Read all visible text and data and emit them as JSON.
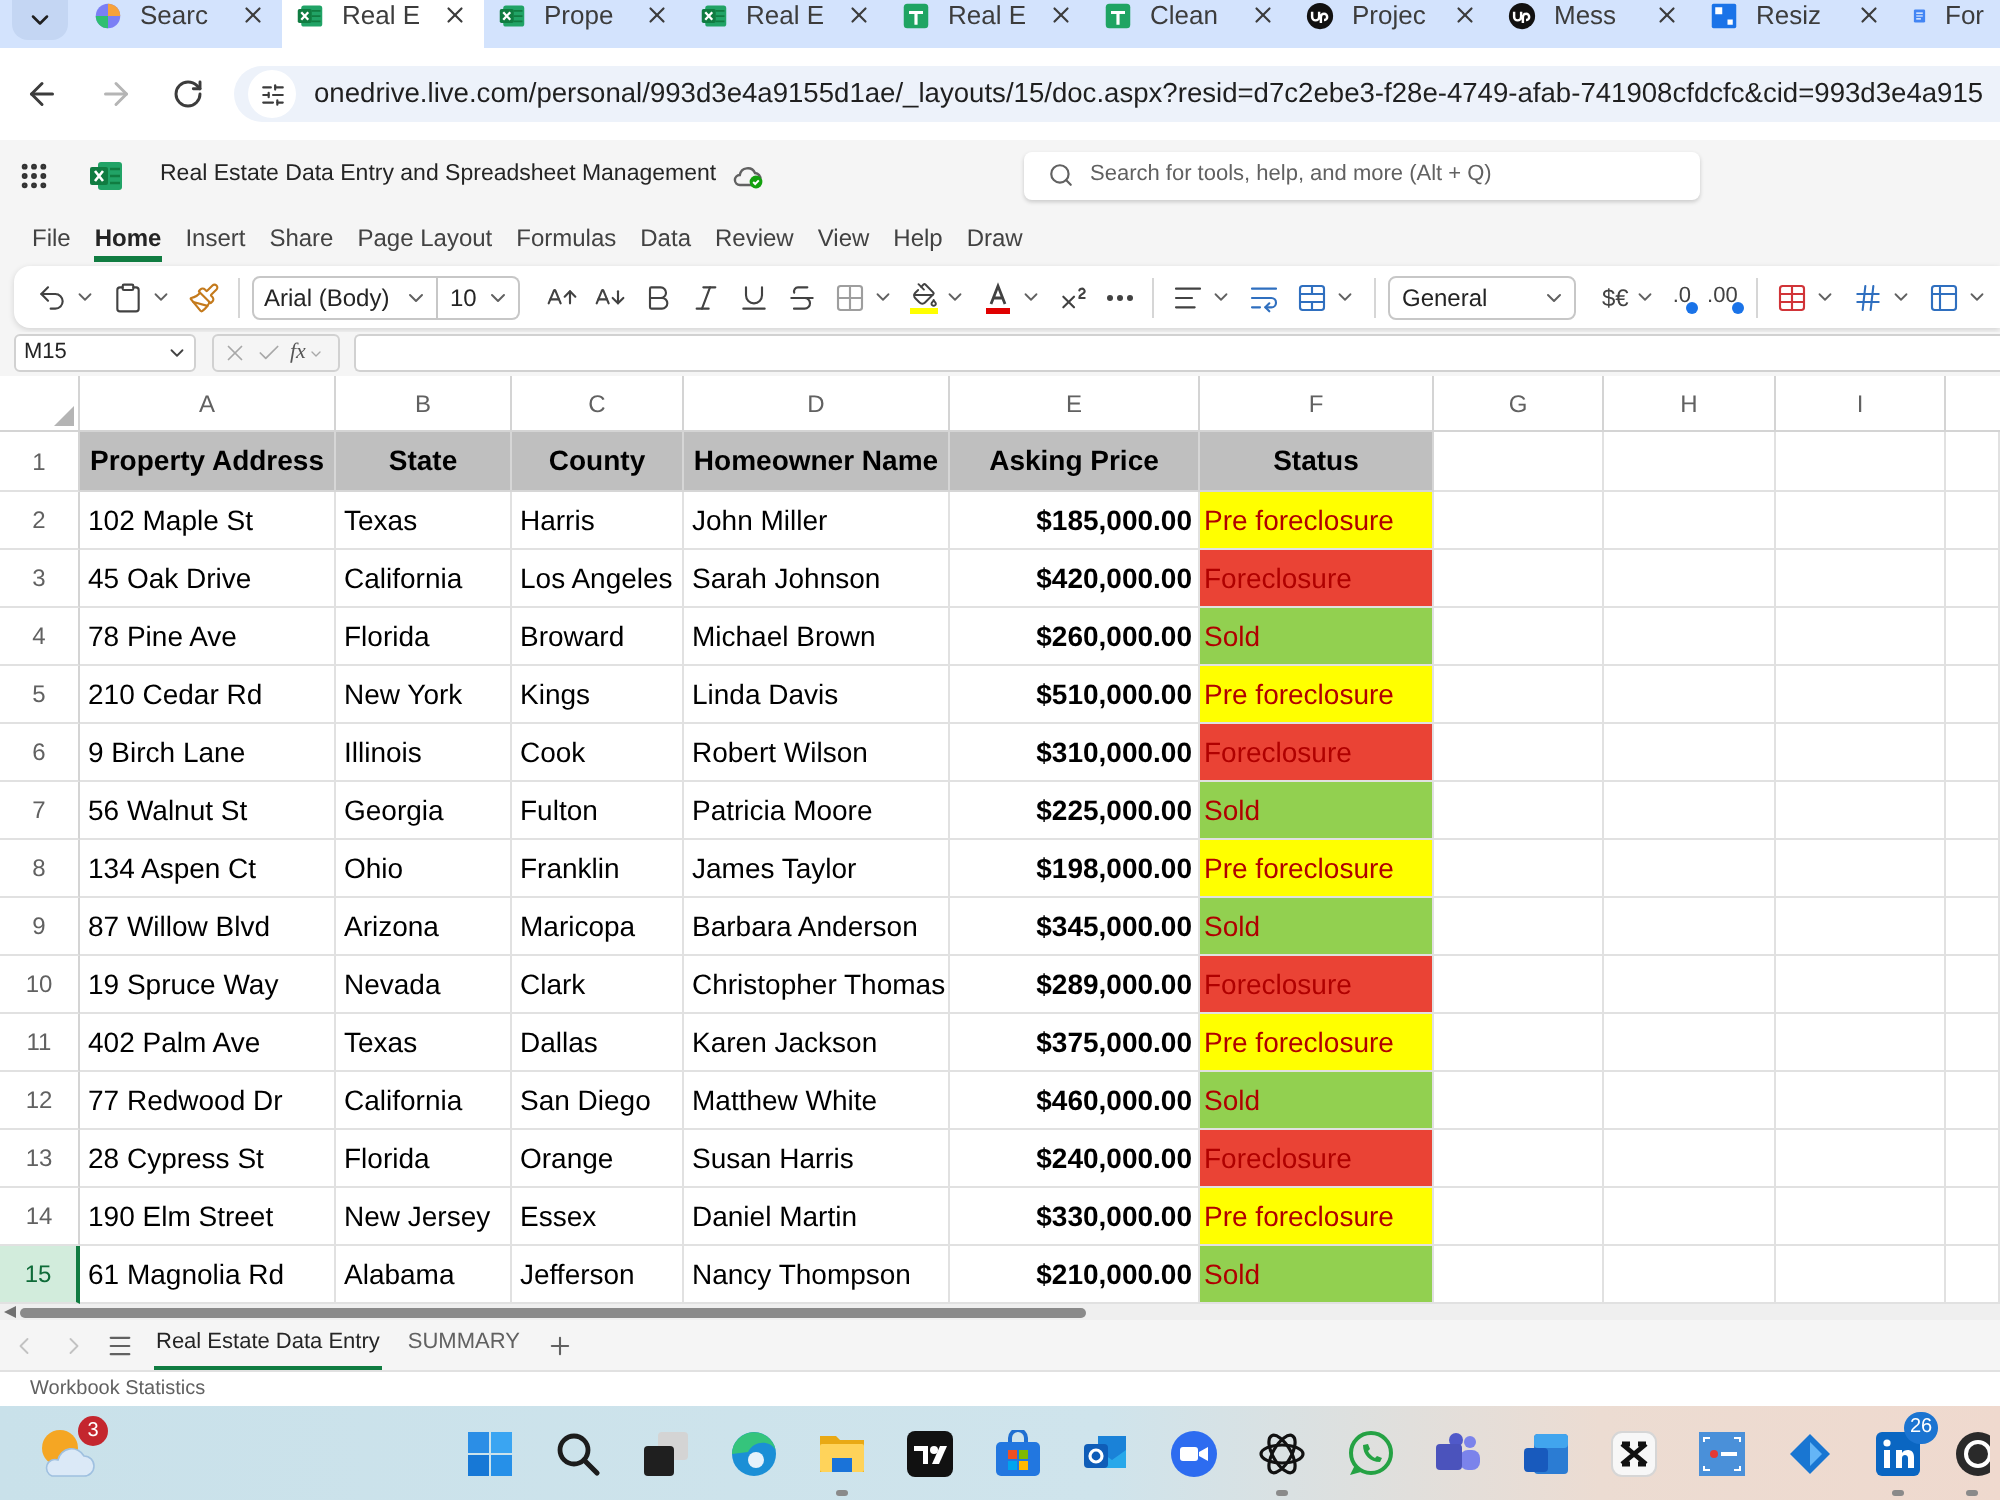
{
  "browser": {
    "tabs": [
      {
        "title": "Searc",
        "selected": false
      },
      {
        "title": "Real E",
        "selected": true
      },
      {
        "title": "Prope",
        "selected": false
      },
      {
        "title": "Real E",
        "selected": false
      },
      {
        "title": "Real E",
        "selected": false
      },
      {
        "title": "Clean",
        "selected": false
      },
      {
        "title": "Projec",
        "selected": false
      },
      {
        "title": "Mess",
        "selected": false
      },
      {
        "title": "Resiz",
        "selected": false
      },
      {
        "title": "For",
        "selected": false
      }
    ],
    "back": {
      "disabled": false
    },
    "forward": {
      "disabled": true
    },
    "url": "onedrive.live.com/personal/993d3e4a9155d1ae/_layouts/15/doc.aspx?resid=d7c2ebe3-f28e-4749-afab-741908cfdcfc&cid=993d3e4a915"
  },
  "app": {
    "title": "Real Estate Data Entry and Spreadsheet Management",
    "search": {
      "placeholder": "Search for tools, help, and more (Alt + Q)"
    }
  },
  "ribbon_tabs": [
    {
      "label": "File",
      "selected": false
    },
    {
      "label": "Home",
      "selected": true
    },
    {
      "label": "Insert",
      "selected": false
    },
    {
      "label": "Share",
      "selected": false
    },
    {
      "label": "Page Layout",
      "selected": false
    },
    {
      "label": "Formulas",
      "selected": false
    },
    {
      "label": "Data",
      "selected": false
    },
    {
      "label": "Review",
      "selected": false
    },
    {
      "label": "View",
      "selected": false
    },
    {
      "label": "Help",
      "selected": false
    },
    {
      "label": "Draw",
      "selected": false
    }
  ],
  "toolbar": {
    "font": "Arial (Body)",
    "font_size": "10",
    "number_format": "General",
    "currency": "$€",
    "increase_decimal": ".0",
    "decrease_decimal": ".00"
  },
  "formula_bar": {
    "name_box": "M15",
    "function_label": "fx"
  },
  "sheet": {
    "columns": [
      "A",
      "B",
      "C",
      "D",
      "E",
      "F",
      "G",
      "H",
      "I"
    ],
    "header_row": {
      "number": "1",
      "selected": false,
      "cells": [
        "Property Address",
        "State",
        "County",
        "Homeowner Name",
        "Asking Price",
        "Status"
      ]
    },
    "rows": [
      {
        "number": "2",
        "selected": false,
        "cells": [
          "102 Maple St",
          "Texas",
          "Harris",
          "John Miller",
          "$185,000.00"
        ],
        "status": {
          "text": "Pre foreclosure",
          "color": "#ffff00"
        }
      },
      {
        "number": "3",
        "selected": false,
        "cells": [
          "45 Oak Drive",
          "California",
          "Los Angeles",
          "Sarah Johnson",
          "$420,000.00"
        ],
        "status": {
          "text": "Foreclosure",
          "color": "#ea4335"
        }
      },
      {
        "number": "4",
        "selected": false,
        "cells": [
          "78 Pine Ave",
          "Florida",
          "Broward",
          "Michael Brown",
          "$260,000.00"
        ],
        "status": {
          "text": "Sold",
          "color": "#92d050"
        }
      },
      {
        "number": "5",
        "selected": false,
        "cells": [
          "210 Cedar Rd",
          "New York",
          "Kings",
          "Linda Davis",
          "$510,000.00"
        ],
        "status": {
          "text": "Pre foreclosure",
          "color": "#ffff00"
        }
      },
      {
        "number": "6",
        "selected": false,
        "cells": [
          "9 Birch Lane",
          "Illinois",
          "Cook",
          "Robert Wilson",
          "$310,000.00"
        ],
        "status": {
          "text": "Foreclosure",
          "color": "#ea4335"
        }
      },
      {
        "number": "7",
        "selected": false,
        "cells": [
          "56 Walnut St",
          "Georgia",
          "Fulton",
          "Patricia Moore",
          "$225,000.00"
        ],
        "status": {
          "text": "Sold",
          "color": "#92d050"
        }
      },
      {
        "number": "8",
        "selected": false,
        "cells": [
          "134 Aspen Ct",
          "Ohio",
          "Franklin",
          "James Taylor",
          "$198,000.00"
        ],
        "status": {
          "text": "Pre foreclosure",
          "color": "#ffff00"
        }
      },
      {
        "number": "9",
        "selected": false,
        "cells": [
          "87 Willow Blvd",
          "Arizona",
          "Maricopa",
          "Barbara Anderson",
          "$345,000.00"
        ],
        "status": {
          "text": "Sold",
          "color": "#92d050"
        }
      },
      {
        "number": "10",
        "selected": false,
        "cells": [
          "19 Spruce Way",
          "Nevada",
          "Clark",
          "Christopher Thomas",
          "$289,000.00"
        ],
        "status": {
          "text": "Foreclosure",
          "color": "#ea4335"
        }
      },
      {
        "number": "11",
        "selected": false,
        "cells": [
          "402 Palm Ave",
          "Texas",
          "Dallas",
          "Karen Jackson",
          "$375,000.00"
        ],
        "status": {
          "text": "Pre foreclosure",
          "color": "#ffff00"
        }
      },
      {
        "number": "12",
        "selected": false,
        "cells": [
          "77 Redwood Dr",
          "California",
          "San Diego",
          "Matthew White",
          "$460,000.00"
        ],
        "status": {
          "text": "Sold",
          "color": "#92d050"
        }
      },
      {
        "number": "13",
        "selected": false,
        "cells": [
          "28 Cypress St",
          "Florida",
          "Orange",
          "Susan Harris",
          "$240,000.00"
        ],
        "status": {
          "text": "Foreclosure",
          "color": "#ea4335"
        }
      },
      {
        "number": "14",
        "selected": false,
        "cells": [
          "190 Elm Street",
          "New Jersey",
          "Essex",
          "Daniel Martin",
          "$330,000.00"
        ],
        "status": {
          "text": "Pre foreclosure",
          "color": "#ffff00"
        }
      },
      {
        "number": "15",
        "selected": true,
        "cells": [
          "61 Magnolia Rd",
          "Alabama",
          "Jefferson",
          "Nancy Thompson",
          "$210,000.00"
        ],
        "status": {
          "text": "Sold",
          "color": "#92d050"
        }
      }
    ]
  },
  "sheet_tabs": [
    {
      "label": "Real Estate Data Entry",
      "selected": true
    },
    {
      "label": "SUMMARY",
      "selected": false
    }
  ],
  "status_bar": {
    "text": "Workbook Statistics"
  },
  "taskbar": {
    "weather": {
      "badge": "3"
    },
    "apps": [
      {
        "running": false
      },
      {
        "running": false
      },
      {
        "running": false
      },
      {
        "running": false
      },
      {
        "running": true
      },
      {
        "running": false
      },
      {
        "running": false
      },
      {
        "running": false
      },
      {
        "running": false
      },
      {
        "running": true
      },
      {
        "running": false
      },
      {
        "running": false
      },
      {
        "running": false
      },
      {
        "running": false
      },
      {
        "running": false
      },
      {
        "running": false
      },
      {
        "running": true,
        "badge": "26"
      },
      {
        "running": true
      }
    ]
  }
}
